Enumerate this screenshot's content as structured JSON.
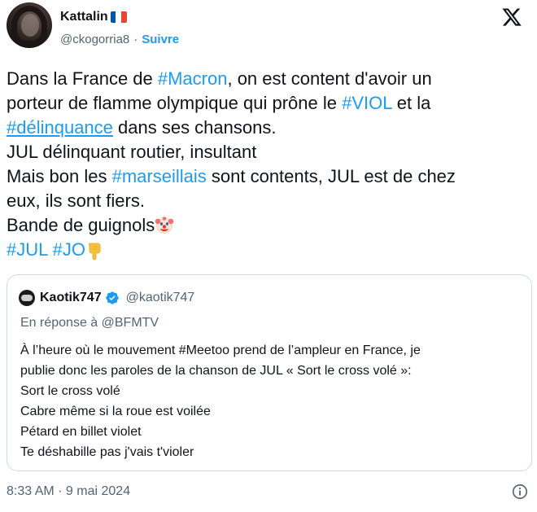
{
  "author": {
    "name": "Kattalin",
    "handle": "@ckogorria8",
    "separator": "·",
    "follow_label": "Suivre",
    "flag_colors": [
      "#0055a4",
      "#ffffff",
      "#ef4135"
    ]
  },
  "tweet": {
    "lines": [
      {
        "t1": "Dans la France de ",
        "tag1": "#Macron",
        "t2": ", on est content d'avoir un"
      },
      {
        "t1": "porteur de flamme olympique qui prône le ",
        "tag1": "#VIOL",
        "t2": " et la"
      },
      {
        "tag1": "#délinquance",
        "t2": " dans ses chansons."
      },
      {
        "t1": "JUL délinquant routier, insultant"
      },
      {
        "t1": "Mais bon les ",
        "tag1": "#marseillais",
        "t2": " sont contents, JUL est de chez"
      },
      {
        "t1": "eux, ils sont fiers."
      },
      {
        "t1": "Bande de guignols"
      },
      {
        "tag1": "#JUL",
        "tag2": "#JO"
      }
    ],
    "emojis": [
      "clown-face",
      "backhand-index-pointing-down"
    ],
    "timestamp": "8:33 AM · 9 mai 2024"
  },
  "quote": {
    "name": "Kaotik747",
    "handle": "@kaotik747",
    "reply_to": "En réponse à @BFMTV",
    "lines": [
      "À l’heure où le mouvement #Meetoo prend de l’ampleur en France, je",
      "publie donc les paroles de la chanson de JUL « Sort le cross volé »:",
      "Sort le cross volé",
      "Cabre même si la roue est voilée",
      "Pétard en billet violet",
      "Te déshabille pas j'vais t'violer"
    ]
  },
  "icons": {
    "logo": "x-logo-icon",
    "verified": "verified-badge-icon",
    "info": "info-icon"
  },
  "colors": {
    "link": "#1d9bf0",
    "text": "#0f1419",
    "secondary": "#536471",
    "border": "#cfd9de"
  }
}
